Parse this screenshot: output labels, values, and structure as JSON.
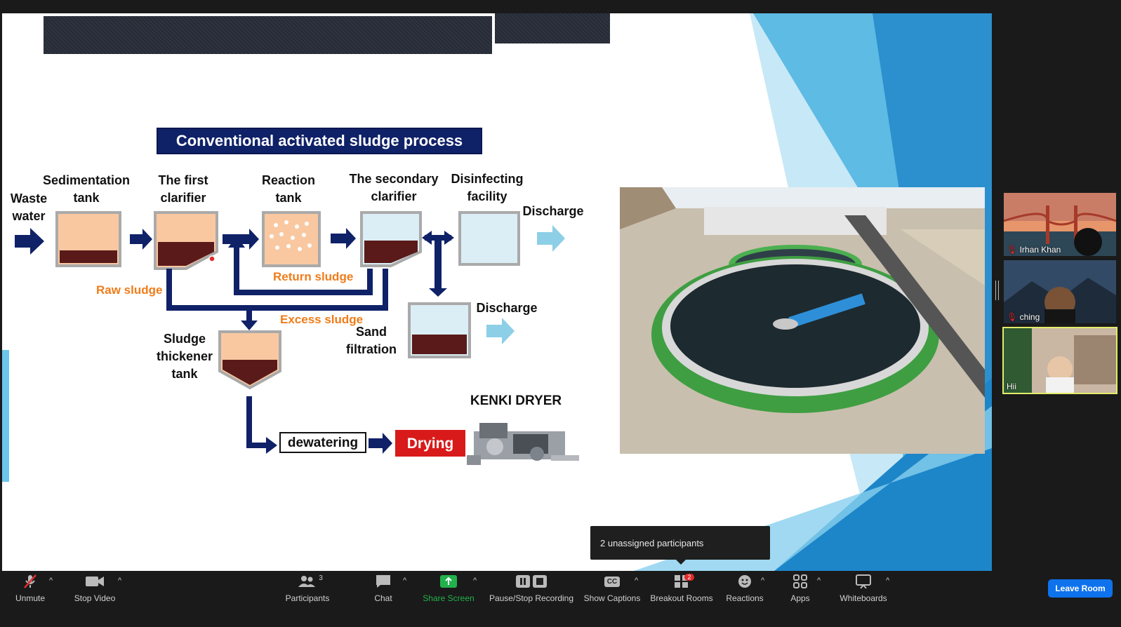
{
  "diagram": {
    "title": "Conventional activated sludge process",
    "labels": {
      "waste_water": "Waste\nwater",
      "sedimentation": "Sedimentation\ntank",
      "first_clarifier": "The first\nclarifier",
      "reaction": "Reaction\ntank",
      "secondary": "The secondary\nclarifier",
      "disinfecting": "Disinfecting\nfacility",
      "discharge_top": "Discharge",
      "discharge_bottom": "Discharge",
      "raw_sludge": "Raw sludge",
      "return_sludge": "Return sludge",
      "excess_sludge": "Excess sludge",
      "sand_filtration": "Sand\nfiltration",
      "thickener": "Sludge\nthickener\ntank",
      "dewatering": "dewatering",
      "drying": "Drying",
      "dryer": "KENKI DRYER"
    }
  },
  "participants": [
    {
      "name": "Irhan Khan",
      "muted": true
    },
    {
      "name": "ching",
      "muted": true
    },
    {
      "name": "Hii",
      "muted": false
    }
  ],
  "tooltip": "2 unassigned participants",
  "toolbar": {
    "unmute": "Unmute",
    "stop_video": "Stop Video",
    "participants": "Participants",
    "participants_count": "3",
    "chat": "Chat",
    "share_screen": "Share Screen",
    "recording": "Pause/Stop Recording",
    "captions": "Show Captions",
    "breakout": "Breakout Rooms",
    "breakout_badge": "2",
    "reactions": "Reactions",
    "apps": "Apps",
    "whiteboards": "Whiteboards",
    "leave": "Leave Room",
    "captions_icon": "CC"
  },
  "colors": {
    "navy": "#0f2167",
    "orange": "#f07c1a",
    "sludge": "#5a1a1a",
    "peach": "#f9c8a0",
    "water": "#dbeef5",
    "light_arrow": "#8ccfe6",
    "drying_red": "#d91a1a",
    "share_green": "#22b14c",
    "leave_blue": "#0e72ed"
  }
}
